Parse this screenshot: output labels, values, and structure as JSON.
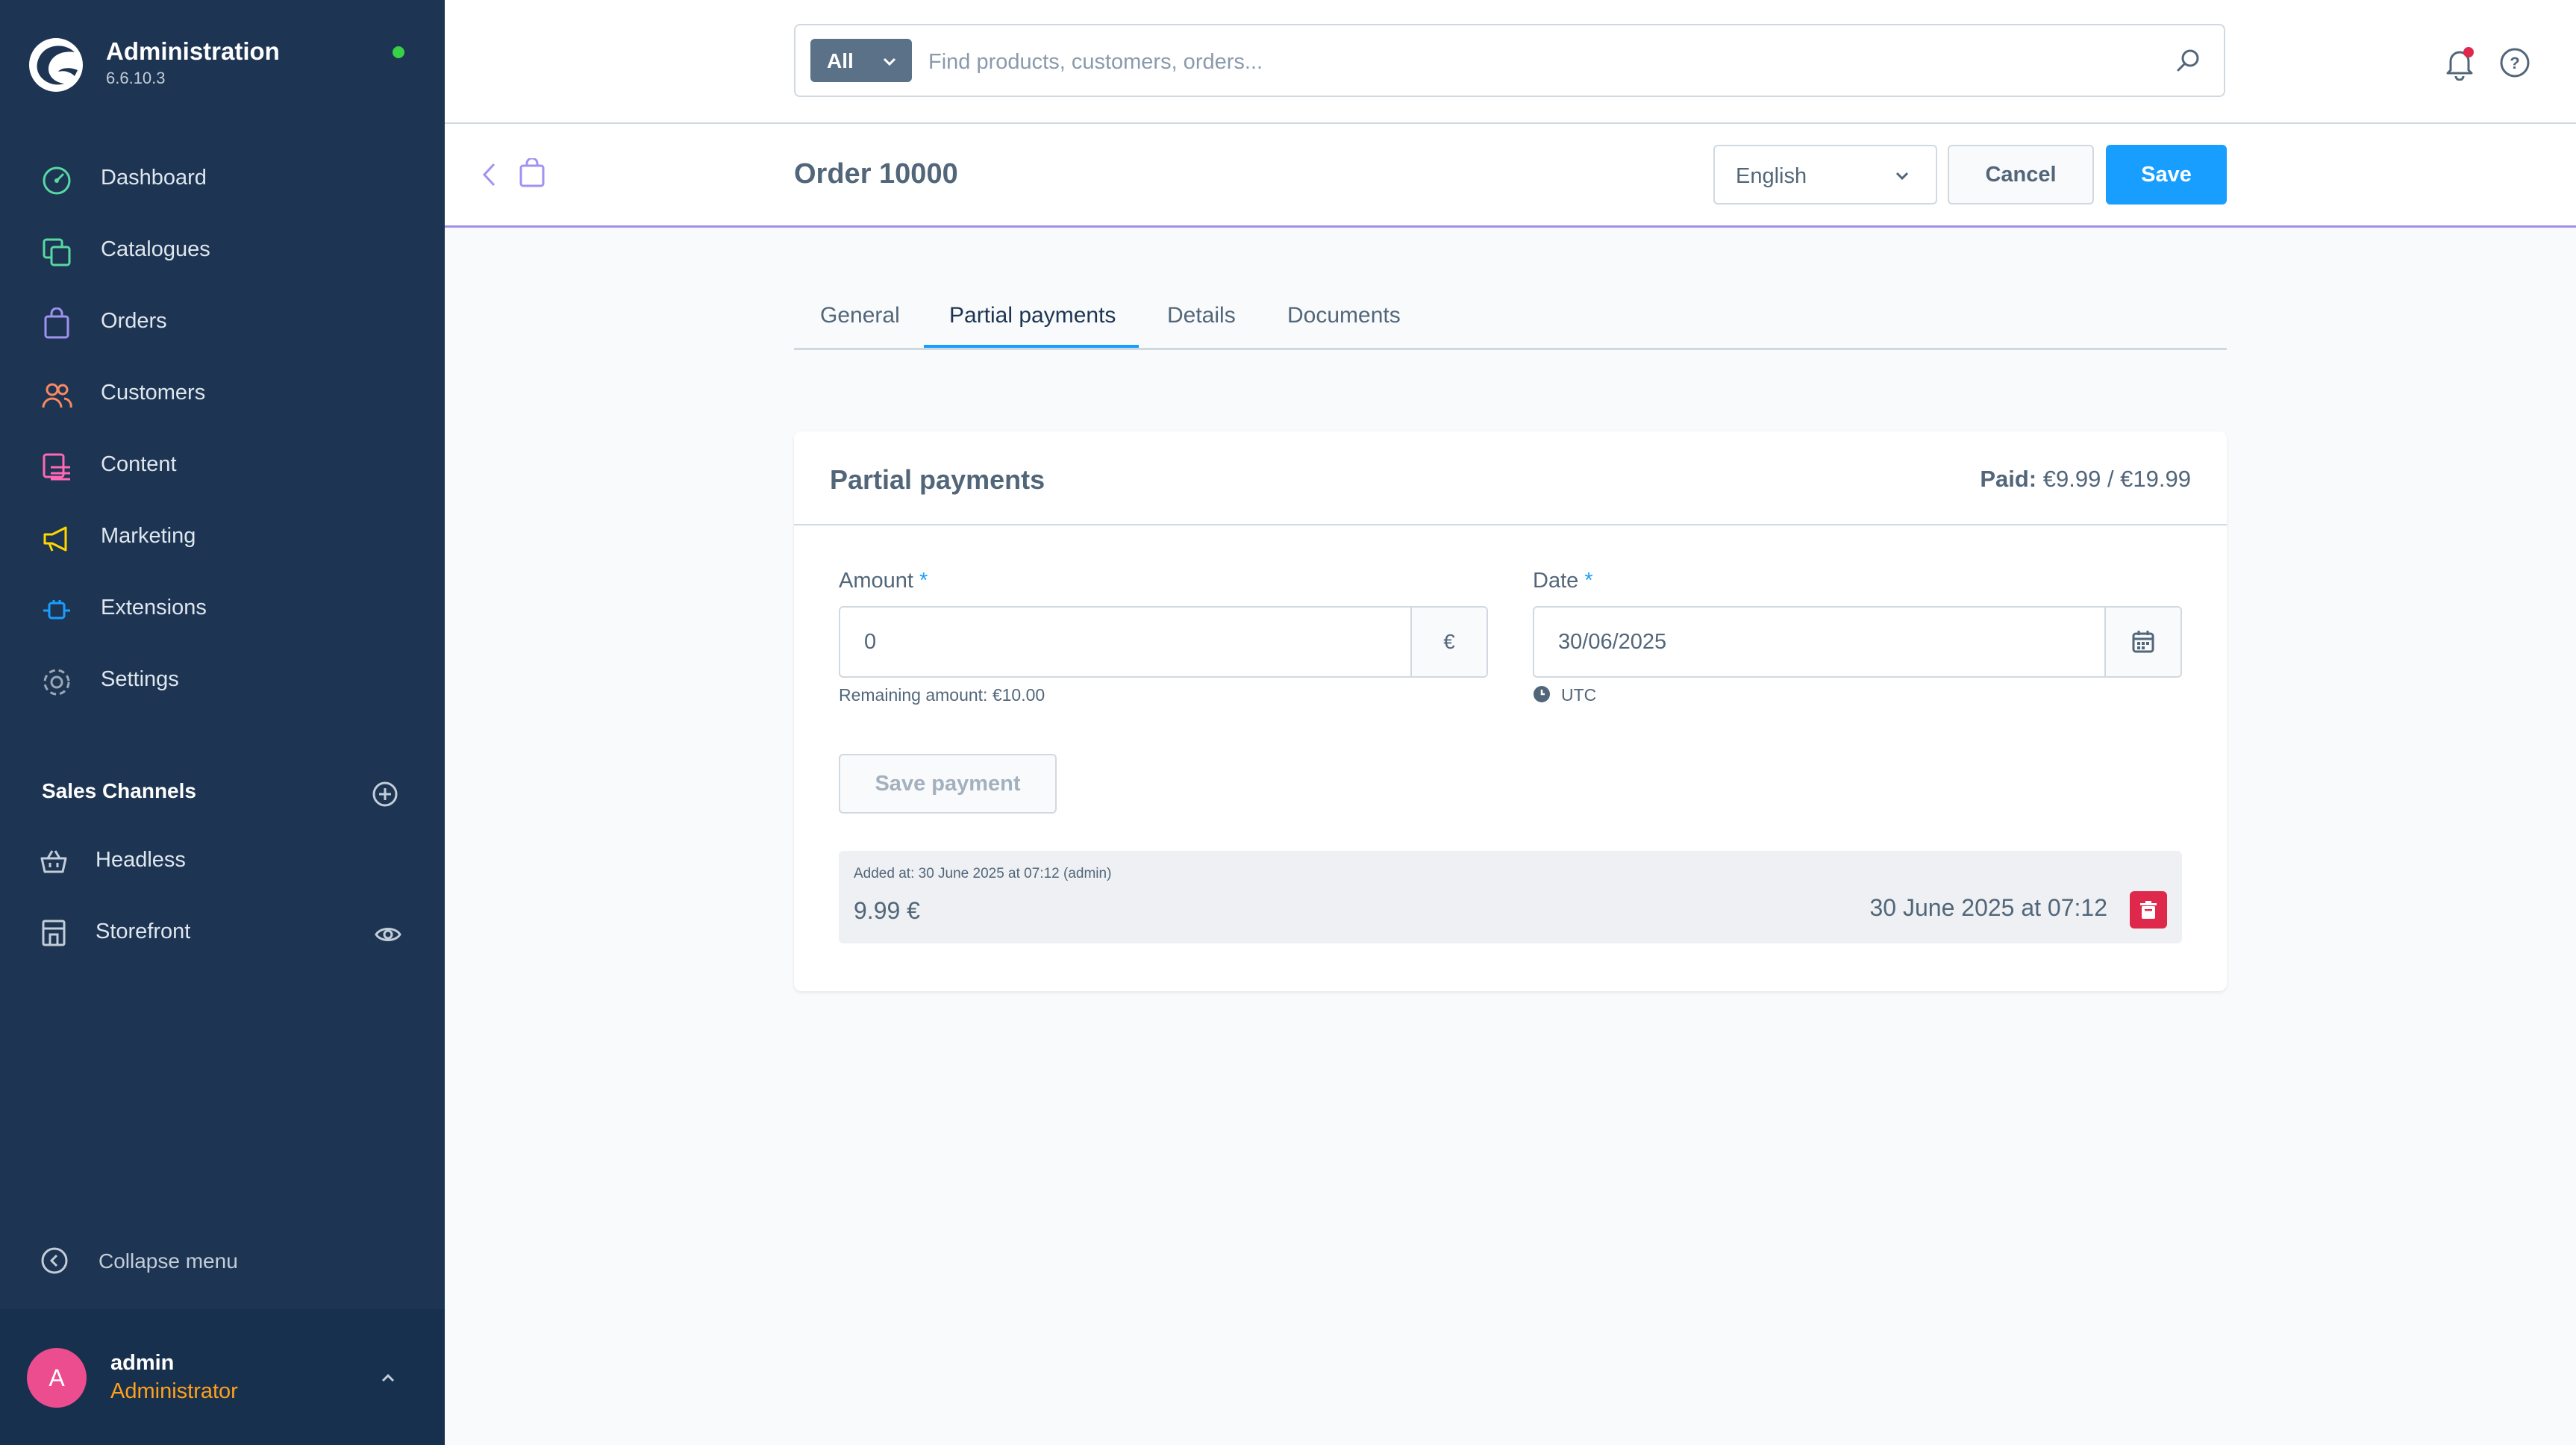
{
  "sidebar": {
    "app_title": "Administration",
    "app_version": "6.6.10.3",
    "nav": [
      {
        "label": "Dashboard",
        "icon": "dashboard-icon",
        "color": "#57d9a3"
      },
      {
        "label": "Catalogues",
        "icon": "catalogues-icon",
        "color": "#57d9a3"
      },
      {
        "label": "Orders",
        "icon": "orders-icon",
        "color": "#a092f0"
      },
      {
        "label": "Customers",
        "icon": "customers-icon",
        "color": "#f88962"
      },
      {
        "label": "Content",
        "icon": "content-icon",
        "color": "#ff68b4"
      },
      {
        "label": "Marketing",
        "icon": "marketing-icon",
        "color": "#ffd700"
      },
      {
        "label": "Extensions",
        "icon": "extensions-icon",
        "color": "#189eff"
      },
      {
        "label": "Settings",
        "icon": "settings-icon",
        "color": "#9aa8b5"
      }
    ],
    "sales_channels_heading": "Sales Channels",
    "sales_channels": [
      {
        "label": "Headless",
        "icon": "basket-icon"
      },
      {
        "label": "Storefront",
        "icon": "storefront-icon"
      }
    ],
    "collapse_label": "Collapse menu",
    "user": {
      "initial": "A",
      "name": "admin",
      "role": "Administrator"
    }
  },
  "search": {
    "type_label": "All",
    "placeholder": "Find products, customers, orders..."
  },
  "smartbar": {
    "title": "Order 10000",
    "language": "English",
    "cancel_label": "Cancel",
    "save_label": "Save"
  },
  "tabs": [
    {
      "label": "General",
      "active": false
    },
    {
      "label": "Partial payments",
      "active": true
    },
    {
      "label": "Details",
      "active": false
    },
    {
      "label": "Documents",
      "active": false
    }
  ],
  "card": {
    "title": "Partial payments",
    "paid_label": "Paid:",
    "paid_value": "€9.99 / €19.99",
    "amount_label": "Amount",
    "required_mark": "*",
    "amount_value": "0",
    "currency_suffix": "€",
    "remaining": "Remaining amount: €10.00",
    "date_label": "Date",
    "date_value": "30/06/2025",
    "timezone": "UTC",
    "save_payment_label": "Save payment",
    "payments": [
      {
        "added": "Added at: 30 June 2025 at 07:12 (admin)",
        "amount": "9.99 €",
        "date": "30 June 2025 at 07:12"
      }
    ]
  },
  "colors": {
    "sidebar_bg": "#1d3552",
    "primary": "#189eff",
    "danger": "#de294c",
    "status_online": "#37d046",
    "role": "#ffa01d",
    "avatar": "#ec4d8e"
  }
}
